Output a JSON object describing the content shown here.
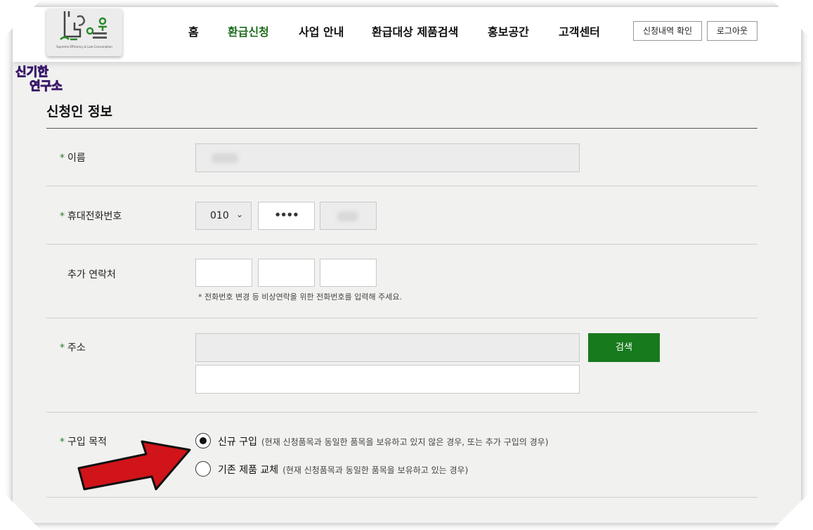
{
  "header": {
    "logo_subtitle": "Supreme Efficiency & Low Consumption",
    "nav": [
      {
        "label": "홈"
      },
      {
        "label": "환급신청"
      },
      {
        "label": "사업 안내"
      },
      {
        "label": "환급대상 제품검색"
      },
      {
        "label": "홍보공간"
      },
      {
        "label": "고객센터"
      }
    ],
    "check_button": "신청내역 확인",
    "logout_button": "로그아웃"
  },
  "badge": {
    "line1": "신기한",
    "line2": "연구소"
  },
  "section_title": "신청인 정보",
  "form": {
    "name": {
      "label": "이름"
    },
    "mobile": {
      "label": "휴대전화번호",
      "prefix": "010",
      "middle": "••••"
    },
    "extra": {
      "label": "추가 연락처",
      "hint": "* 전화번호 변경 등 비상연락을 위한 전화번호를 입력해 주세요."
    },
    "address": {
      "label": "주소",
      "search_button": "검색"
    },
    "purpose": {
      "label": "구입 목적",
      "options": [
        {
          "label": "신규 구입",
          "desc": "(현재 신청품목과 동일한 품목을 보유하고 있지 않은 경우, 또는 추가 구입의 경우)",
          "selected": true
        },
        {
          "label": "기존 제품 교체",
          "desc": "(현재 신청품목과 동일한 품목을 보유하고 있는 경우)",
          "selected": false
        }
      ]
    }
  },
  "colors": {
    "accent_green": "#177a1d",
    "arrow_red": "#d0141a"
  }
}
